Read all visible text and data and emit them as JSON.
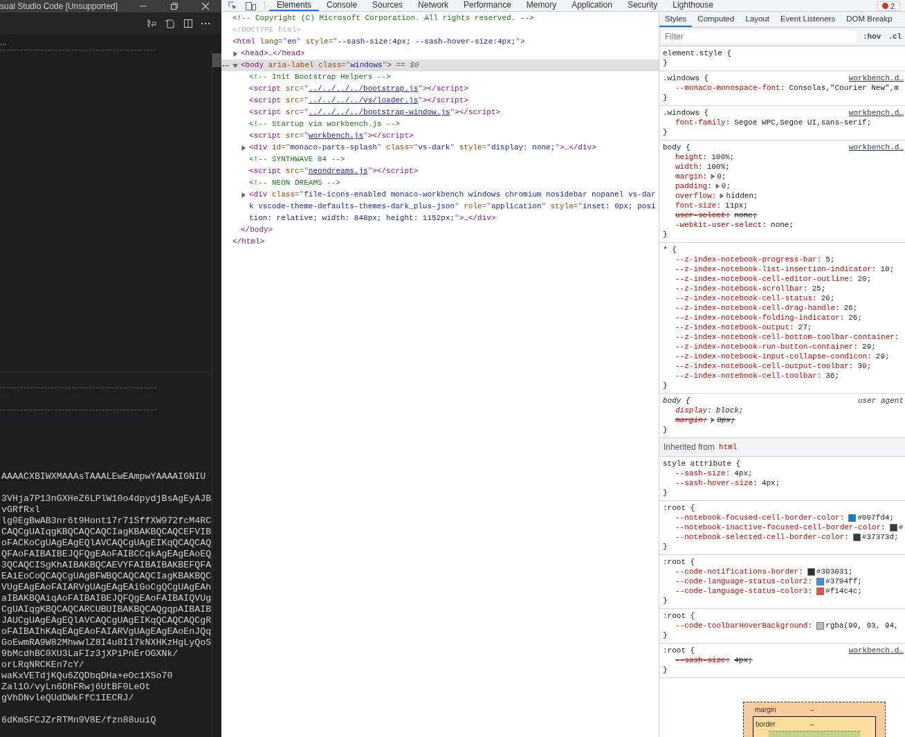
{
  "editor": {
    "title": "sual Studio Code [Unsupported]",
    "breadcrumb": "...",
    "code_blocks": [
      [
        "AAAACXBIWXMAAAsTAAALEwEAmpwYAAAAIGNIU"
      ],
      [
        "3VHja7P13nGXHeZ6LPlW10o4dpydjBsAgEyAJB",
        "vGRfRxl",
        "lg0EgBwAB3nr6t9Hont17r71SffXW972fcM4RC",
        "CAQCgUAIqgKBQCAQCAQCIagKBAKBQCAQCEFVIB",
        "oFACKoCgUAgEAgEQlAVCAQCgUAgEIKqQCAQCAQ",
        "QFAoFAIBAIBEJQFQgEAoFAIBCCqkAgEAgEAoEQ",
        "3QCAQCISgKhAIBAKBQCAEVYFAIBAIBAKBEFQFA",
        "EAiEoCoQCAQCgUAgBFWBQCAQCAQCIagKBAKBQC",
        "VUgEAgEAoFAIARVgUAgEAgEAiGoCgQCgUAgEAh",
        "aIBAKBQAiqAoFAIBAIBEJQFQgEAoFAIBAIQVUg",
        "CgUAIqgKBQCAQCARCUBUIBAKBQCAQgqpAIBAIB",
        "JAUCgUAgEAgEQlAVCAQCgUAgEIKqQCAQCAQCgR",
        "oFAIBAIhKAqEAgEAoFAIARVgUAgEAgEAoEnJQq",
        "GoEwmRA9W82MhwwlZ8I4u8I17kNXHKzHgLyQoS",
        "9bMcdhBC0XU3LaFIz3jXPiPnErOGXNk/",
        "orLRqNRCKEn7cY/",
        "waKxVETdjKQu6ZQDbqDHa+eOc1XSo70",
        "Zal1O/vyLn6DhFRwj6UtBF0LeOt",
        "gVhDNvleQUdDWkFfC1IECRJ/"
      ],
      [
        "6dKmSFCJZrRTMn9V8E/fzn88uuiQ"
      ]
    ]
  },
  "devtools_tabs": [
    {
      "label": "Elements",
      "selected": true
    },
    {
      "label": "Console",
      "selected": false
    },
    {
      "label": "Sources",
      "selected": false
    },
    {
      "label": "Network",
      "selected": false
    },
    {
      "label": "Performance",
      "selected": false
    },
    {
      "label": "Memory",
      "selected": false
    },
    {
      "label": "Application",
      "selected": false
    },
    {
      "label": "Security",
      "selected": false
    },
    {
      "label": "Lighthouse",
      "selected": false
    }
  ],
  "error_badge": "2",
  "elements": {
    "nodes": [
      {
        "selected": false,
        "tokens": [
          {
            "kind": "cmt",
            "text": "<!-- Copyright (C) Microsoft Corporation. All rights reserved. -->"
          }
        ]
      },
      {
        "selected": false,
        "tokens": [
          {
            "kind": "doc",
            "text": "<!DOCTYPE html>"
          }
        ]
      },
      {
        "selected": false,
        "tokens": [
          {
            "kind": "tag",
            "text": "<html"
          },
          {
            "kind": "attr",
            "text": " lang"
          },
          {
            "kind": "punct",
            "text": "=\""
          },
          {
            "kind": "val",
            "text": "en"
          },
          {
            "kind": "punct",
            "text": "\""
          },
          {
            "kind": "attr",
            "text": " style"
          },
          {
            "kind": "punct",
            "text": "=\""
          },
          {
            "kind": "val",
            "text": "--sash-size:4px; --sash-hover-size:4px;"
          },
          {
            "kind": "punct",
            "text": "\""
          },
          {
            "kind": "tag",
            "text": ">"
          }
        ],
        "closing": [
          {
            "kind": "tag",
            "text": "</html>"
          }
        ],
        "children": [
          {
            "selected": false,
            "expanded": false,
            "tokens": [
              {
                "kind": "tag",
                "text": "<head>"
              },
              {
                "kind": "ell",
                "text": "…"
              },
              {
                "kind": "tag",
                "text": "</head>"
              }
            ]
          },
          {
            "selected": true,
            "expanded": true,
            "tokens": [
              {
                "kind": "tag",
                "text": "<body"
              },
              {
                "kind": "attr",
                "text": " aria-label"
              },
              {
                "kind": "attr",
                "text": " class"
              },
              {
                "kind": "punct",
                "text": "=\""
              },
              {
                "kind": "val",
                "text": "windows"
              },
              {
                "kind": "punct",
                "text": "\""
              },
              {
                "kind": "tag",
                "text": ">"
              },
              {
                "kind": "ref",
                "text": " == $0"
              }
            ],
            "closing": [
              {
                "kind": "tag",
                "text": "</body>"
              }
            ],
            "children": [
              {
                "selected": false,
                "tokens": [
                  {
                    "kind": "cmt",
                    "text": "<!-- Init Bootstrap Helpers -->"
                  }
                ]
              },
              {
                "selected": false,
                "tokens": [
                  {
                    "kind": "tag",
                    "text": "<script"
                  },
                  {
                    "kind": "attr",
                    "text": " src"
                  },
                  {
                    "kind": "punct",
                    "text": "=\""
                  },
                  {
                    "kind": "link",
                    "text": "../../../../bootstrap.js"
                  },
                  {
                    "kind": "punct",
                    "text": "\""
                  },
                  {
                    "kind": "tag",
                    "text": "></script>"
                  }
                ]
              },
              {
                "selected": false,
                "tokens": [
                  {
                    "kind": "tag",
                    "text": "<script"
                  },
                  {
                    "kind": "attr",
                    "text": " src"
                  },
                  {
                    "kind": "punct",
                    "text": "=\""
                  },
                  {
                    "kind": "link",
                    "text": "../../../../vs/loader.js"
                  },
                  {
                    "kind": "punct",
                    "text": "\""
                  },
                  {
                    "kind": "tag",
                    "text": "></script>"
                  }
                ]
              },
              {
                "selected": false,
                "tokens": [
                  {
                    "kind": "tag",
                    "text": "<script"
                  },
                  {
                    "kind": "attr",
                    "text": " src"
                  },
                  {
                    "kind": "punct",
                    "text": "=\""
                  },
                  {
                    "kind": "link",
                    "text": "../../../../bootstrap-window.js"
                  },
                  {
                    "kind": "punct",
                    "text": "\""
                  },
                  {
                    "kind": "tag",
                    "text": "></script>"
                  }
                ]
              },
              {
                "selected": false,
                "tokens": [
                  {
                    "kind": "cmt",
                    "text": "<!-- Startup via workbench.js -->"
                  }
                ]
              },
              {
                "selected": false,
                "tokens": [
                  {
                    "kind": "tag",
                    "text": "<script"
                  },
                  {
                    "kind": "attr",
                    "text": " src"
                  },
                  {
                    "kind": "punct",
                    "text": "=\""
                  },
                  {
                    "kind": "link",
                    "text": "workbench.js"
                  },
                  {
                    "kind": "punct",
                    "text": "\""
                  },
                  {
                    "kind": "tag",
                    "text": "></script>"
                  }
                ]
              },
              {
                "selected": false,
                "expanded": false,
                "tokens": [
                  {
                    "kind": "tag",
                    "text": "<div"
                  },
                  {
                    "kind": "attr",
                    "text": " id"
                  },
                  {
                    "kind": "punct",
                    "text": "=\""
                  },
                  {
                    "kind": "val",
                    "text": "monaco-parts-splash"
                  },
                  {
                    "kind": "punct",
                    "text": "\""
                  },
                  {
                    "kind": "attr",
                    "text": " class"
                  },
                  {
                    "kind": "punct",
                    "text": "=\""
                  },
                  {
                    "kind": "val",
                    "text": "vs-dark"
                  },
                  {
                    "kind": "punct",
                    "text": "\""
                  },
                  {
                    "kind": "attr",
                    "text": " style"
                  },
                  {
                    "kind": "punct",
                    "text": "=\""
                  },
                  {
                    "kind": "val",
                    "text": "display: none;"
                  },
                  {
                    "kind": "punct",
                    "text": "\""
                  },
                  {
                    "kind": "tag",
                    "text": ">"
                  },
                  {
                    "kind": "ell",
                    "text": "…"
                  },
                  {
                    "kind": "tag",
                    "text": "</div>"
                  }
                ]
              },
              {
                "selected": false,
                "tokens": [
                  {
                    "kind": "cmt",
                    "text": "<!-- SYNTHWAVE 84 -->"
                  }
                ]
              },
              {
                "selected": false,
                "tokens": [
                  {
                    "kind": "tag",
                    "text": "<script"
                  },
                  {
                    "kind": "attr",
                    "text": " src"
                  },
                  {
                    "kind": "punct",
                    "text": "=\""
                  },
                  {
                    "kind": "link",
                    "text": "neondreams.js"
                  },
                  {
                    "kind": "punct",
                    "text": "\""
                  },
                  {
                    "kind": "tag",
                    "text": "></script>"
                  }
                ]
              },
              {
                "selected": false,
                "tokens": [
                  {
                    "kind": "cmt",
                    "text": "<!-- NEON DREAMS -->"
                  }
                ]
              },
              {
                "selected": false,
                "expanded": false,
                "tokens": [
                  {
                    "kind": "tag",
                    "text": "<div"
                  },
                  {
                    "kind": "attr",
                    "text": " class"
                  },
                  {
                    "kind": "punct",
                    "text": "=\""
                  },
                  {
                    "kind": "val",
                    "text": "file-icons-enabled monaco-workbench windows chromium nosidebar nopanel vs-dark vscode-theme-defaults-themes-dark_plus-json"
                  },
                  {
                    "kind": "punct",
                    "text": "\""
                  },
                  {
                    "kind": "attr",
                    "text": " role"
                  },
                  {
                    "kind": "punct",
                    "text": "=\""
                  },
                  {
                    "kind": "val",
                    "text": "application"
                  },
                  {
                    "kind": "punct",
                    "text": "\""
                  },
                  {
                    "kind": "attr",
                    "text": " style"
                  },
                  {
                    "kind": "punct",
                    "text": "=\""
                  },
                  {
                    "kind": "val",
                    "text": "inset: 0px; position: relative; width: 848px; height: 1152px;"
                  },
                  {
                    "kind": "punct",
                    "text": "\""
                  },
                  {
                    "kind": "tag",
                    "text": ">"
                  },
                  {
                    "kind": "ell",
                    "text": "…"
                  },
                  {
                    "kind": "tag",
                    "text": "</div>"
                  }
                ]
              }
            ]
          }
        ]
      }
    ]
  },
  "styles_panel": {
    "tabs": [
      {
        "label": "Styles",
        "selected": true
      },
      {
        "label": "Computed",
        "selected": false
      },
      {
        "label": "Layout",
        "selected": false
      },
      {
        "label": "Event Listeners",
        "selected": false
      },
      {
        "label": "DOM Breakp",
        "selected": false
      }
    ],
    "filter": {
      "placeholder": "Filter"
    },
    "toggles": [
      ":hov",
      ".cl"
    ],
    "rules": [
      {
        "kind": "rule",
        "selector": "element.style {",
        "close": "}"
      },
      {
        "kind": "rule",
        "selector": ".windows {",
        "source": "workbench.d…",
        "close": "}",
        "props": [
          {
            "text": "--monaco-monospace-font: Consolas,\"Courier New\",m",
            "struck": false,
            "expander": false
          }
        ]
      },
      {
        "kind": "rule",
        "selector": ".windows {",
        "source": "workbench.d…",
        "close": "}",
        "props": [
          {
            "text": "font-family: Segoe WPC,Segoe UI,sans-serif;",
            "struck": false,
            "expander": false
          }
        ]
      },
      {
        "kind": "rule",
        "selector": "body {",
        "source": "workbench.d…",
        "close": "}",
        "props": [
          {
            "text": "height: 100%;",
            "struck": false,
            "expander": false
          },
          {
            "text": "width: 100%;",
            "struck": false,
            "expander": false
          },
          {
            "text": "margin: 0;",
            "struck": false,
            "expander": true
          },
          {
            "text": "padding: 0;",
            "struck": false,
            "expander": true
          },
          {
            "text": "overflow: hidden;",
            "struck": false,
            "expander": true
          },
          {
            "text": "font-size: 11px;",
            "struck": false,
            "expander": false
          },
          {
            "text": "user-select: none;",
            "struck": true,
            "expander": false
          },
          {
            "text": "-webkit-user-select: none;",
            "struck": false,
            "expander": false
          }
        ]
      },
      {
        "kind": "rule",
        "selector": "* {",
        "close": "}",
        "props": [
          {
            "text": "--z-index-notebook-progress-bar: 5;",
            "struck": false,
            "expander": false
          },
          {
            "text": "--z-index-notebook-list-insertion-indicator: 10;",
            "struck": false,
            "expander": false
          },
          {
            "text": "--z-index-notebook-cell-editor-outline: 20;",
            "struck": false,
            "expander": false
          },
          {
            "text": "--z-index-notebook-scrollbar: 25;",
            "struck": false,
            "expander": false
          },
          {
            "text": "--z-index-notebook-cell-status: 26;",
            "struck": false,
            "expander": false
          },
          {
            "text": "--z-index-notebook-cell-drag-handle: 26;",
            "struck": false,
            "expander": false
          },
          {
            "text": "--z-index-notebook-folding-indicator: 26;",
            "struck": false,
            "expander": false
          },
          {
            "text": "--z-index-notebook-output: 27;",
            "struck": false,
            "expander": false
          },
          {
            "text": "--z-index-notebook-cell-bottom-toolbar-container:",
            "struck": false,
            "expander": false
          },
          {
            "text": "--z-index-notebook-run-button-container: 29;",
            "struck": false,
            "expander": false
          },
          {
            "text": "--z-index-notebook-input-collapse-condicon: 29;",
            "struck": false,
            "expander": false
          },
          {
            "text": "--z-index-notebook-cell-output-toolbar: 30;",
            "struck": false,
            "expander": false
          },
          {
            "text": "--z-index-notebook-cell-toolbar: 36;",
            "struck": false,
            "expander": false
          }
        ]
      },
      {
        "kind": "user_agent",
        "selector": "body {",
        "source": "user agent",
        "close": "}",
        "props": [
          {
            "text": "display: block;",
            "struck": false,
            "expander": false
          },
          {
            "text": "margin: 8px;",
            "struck": true,
            "expander": true
          }
        ]
      },
      {
        "kind": "inherited",
        "label": "Inherited from",
        "target": "html"
      },
      {
        "kind": "rule",
        "selector": "style attribute {",
        "close": "}",
        "props": [
          {
            "text": "--sash-size: 4px;",
            "struck": false,
            "expander": false
          },
          {
            "text": "--sash-hover-size: 4px;",
            "struck": false,
            "expander": false
          }
        ]
      },
      {
        "kind": "rule",
        "selector": ":root {",
        "close": "}",
        "props": [
          {
            "text": "--notebook-focused-cell-border-color: #007fd4;",
            "struck": false,
            "expander": false,
            "color": "#007fd4"
          },
          {
            "text": "--notebook-inactive-focused-cell-border-color: #",
            "struck": false,
            "expander": false,
            "color": "#37373d"
          },
          {
            "text": "--notebook-selected-cell-border-color: #37373d;",
            "struck": false,
            "expander": false,
            "color": "#37373d"
          }
        ]
      },
      {
        "kind": "rule",
        "selector": ":root {",
        "close": "}",
        "props": [
          {
            "text": "--code-notifications-border: #303031;",
            "struck": false,
            "expander": false,
            "color": "#303031"
          },
          {
            "text": "--code-language-status-color2: #3794ff;",
            "struck": false,
            "expander": false,
            "color": "#3794ff"
          },
          {
            "text": "--code-language-status-color3: #f14c4c;",
            "struck": false,
            "expander": false,
            "color": "#f14c4c"
          }
        ]
      },
      {
        "kind": "rule",
        "selector": ":root {",
        "close": "}",
        "props": [
          {
            "text": "--code-toolbarHoverBackground: rgba(90, 93, 94,",
            "struck": false,
            "expander": false,
            "color": "#b9baba"
          }
        ]
      },
      {
        "kind": "rule",
        "selector": ":root {",
        "source": "workbench.d…",
        "close": "}",
        "props": [
          {
            "text": "--sash-size: 4px;",
            "struck": true,
            "expander": false
          }
        ]
      }
    ],
    "box_model": {
      "margin": {
        "label": "margin",
        "value": "–"
      },
      "border": {
        "label": "border",
        "value": "–"
      }
    }
  }
}
